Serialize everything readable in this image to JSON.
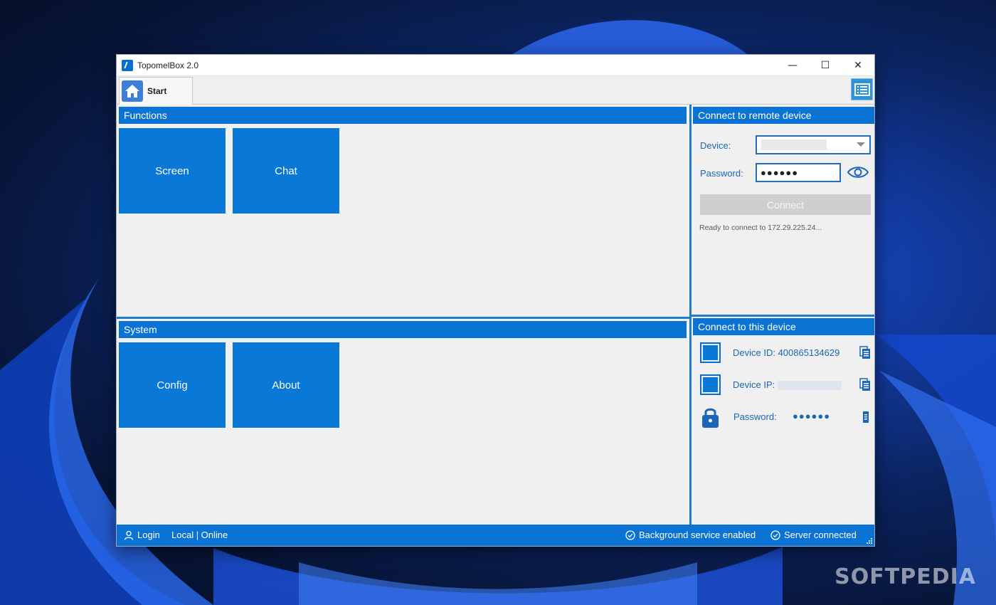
{
  "window": {
    "title": "TopomelBox 2.0",
    "controls": {
      "minimize": "—",
      "maximize": "☐",
      "close": "✕"
    }
  },
  "tabs": {
    "start_label": "Start"
  },
  "functions": {
    "header": "Functions",
    "tiles": [
      "Screen",
      "Chat"
    ]
  },
  "system": {
    "header": "System",
    "tiles": [
      "Config",
      "About"
    ]
  },
  "remote": {
    "header": "Connect to remote device",
    "device_label": "Device:",
    "password_label": "Password:",
    "password_value": "●●●●●●",
    "connect_label": "Connect",
    "status": "Ready to connect to 172.29.225.24..."
  },
  "this_device": {
    "header": "Connect to this device",
    "device_id_text": "Device ID: 400865134629",
    "device_ip_label": "Device IP:",
    "password_label": "Password:",
    "password_value": "●●●●●●"
  },
  "statusbar": {
    "login": "Login",
    "mode": "Local | Online",
    "background_service": "Background service enabled",
    "server": "Server connected"
  },
  "watermark": "SOFTPEDIA",
  "colors": {
    "accent": "#0a73d4",
    "tile": "#0a78d7",
    "label": "#1a66b8"
  }
}
